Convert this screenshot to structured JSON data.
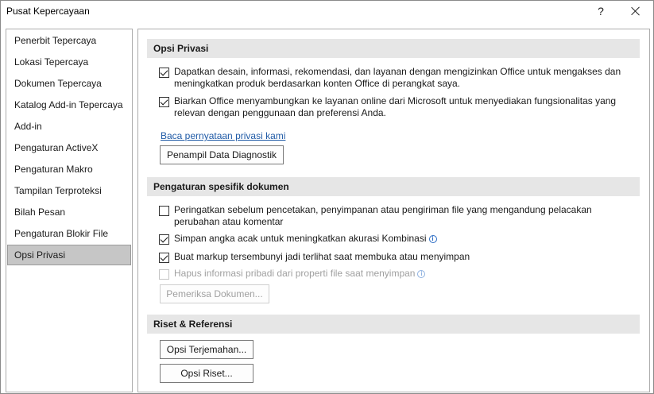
{
  "window": {
    "title": "Pusat Kepercayaan",
    "help_glyph": "?"
  },
  "sidebar": {
    "items": [
      {
        "label": "Penerbit Tepercaya"
      },
      {
        "label": "Lokasi Tepercaya"
      },
      {
        "label": "Dokumen Tepercaya"
      },
      {
        "label": "Katalog Add-in Tepercaya"
      },
      {
        "label": "Add-in"
      },
      {
        "label": "Pengaturan ActiveX"
      },
      {
        "label": "Pengaturan Makro"
      },
      {
        "label": "Tampilan Terproteksi"
      },
      {
        "label": "Bilah Pesan"
      },
      {
        "label": "Pengaturan Blokir File"
      },
      {
        "label": "Opsi Privasi",
        "selected": true
      }
    ]
  },
  "privacy": {
    "header": "Opsi Privasi",
    "options": [
      {
        "label": "Dapatkan desain, informasi, rekomendasi, dan layanan dengan mengizinkan Office untuk mengakses dan meningkatkan produk berdasarkan konten Office di perangkat saya.",
        "checked": true
      },
      {
        "label": "Biarkan Office menyambungkan ke layanan online dari Microsoft untuk menyediakan fungsionalitas yang relevan dengan penggunaan dan preferensi Anda.",
        "checked": true
      }
    ],
    "link": "Baca pernyataan privasi kami",
    "diagnostic_button": "Penampil Data Diagnostik"
  },
  "document": {
    "header": "Pengaturan spesifik dokumen",
    "options": [
      {
        "label": "Peringatkan sebelum pencetakan, penyimpanan atau pengiriman file yang mengandung pelacakan perubahan atau komentar",
        "checked": false
      },
      {
        "label": "Simpan angka acak untuk meningkatkan akurasi Kombinasi",
        "checked": true,
        "info": true
      },
      {
        "label": "Buat markup tersembunyi jadi terlihat saat membuka atau menyimpan",
        "checked": true
      },
      {
        "label": "Hapus informasi pribadi dari properti file saat menyimpan",
        "checked": false,
        "disabled": true,
        "info": true
      }
    ],
    "inspect_button": "Pemeriksa Dokumen..."
  },
  "research": {
    "header": "Riset & Referensi",
    "translation_button": "Opsi Terjemahan...",
    "research_button": "Opsi Riset..."
  },
  "icons": {
    "info": "info-circle-icon",
    "close": "close-icon",
    "help": "help-icon"
  },
  "colors": {
    "link": "#1f5aa6",
    "selected_bg": "#c6c6c6",
    "section_bg": "#e6e6e6",
    "info": "#2b6cc4"
  }
}
